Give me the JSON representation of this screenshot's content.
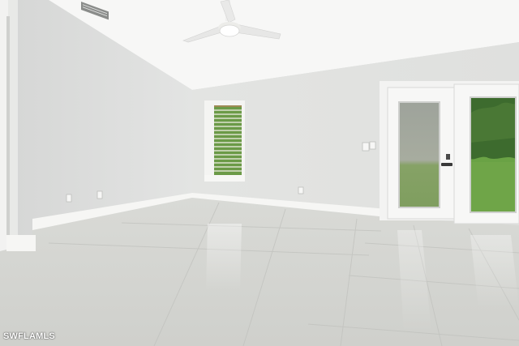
{
  "watermark": {
    "text": "SWFLAMLS"
  },
  "colors": {
    "ceiling": "#f7f7f6",
    "left_wall": "#dcdddc",
    "back_wall": "#e2e3e1",
    "floor": "#d4d5d1",
    "trim": "#f6f6f4",
    "grass": "#6fa548",
    "trees": "#3d6b2e"
  },
  "icons": {
    "ceiling_fan": "ceiling-fan-icon",
    "vent": "air-vent-icon",
    "door_handle": "door-handle-icon"
  }
}
